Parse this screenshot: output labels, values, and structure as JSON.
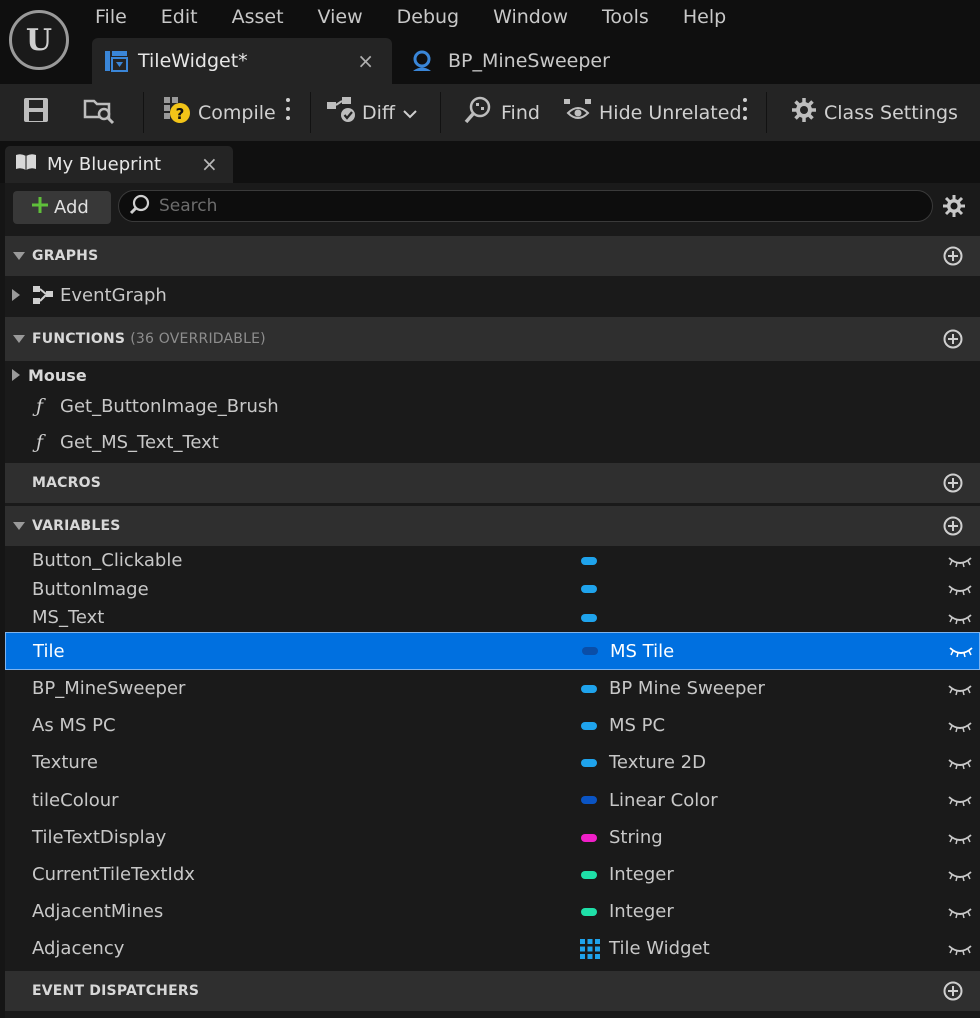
{
  "menu": [
    "File",
    "Edit",
    "Asset",
    "View",
    "Debug",
    "Window",
    "Tools",
    "Help"
  ],
  "logo_text": "U",
  "tabs": [
    {
      "label": "TileWidget*",
      "close": "×"
    },
    {
      "label": "BP_MineSweeper"
    }
  ],
  "toolbar": {
    "compile": "Compile",
    "diff": "Diff",
    "find": "Find",
    "hide_unrelated": "Hide Unrelated",
    "class_settings": "Class Settings"
  },
  "panel": {
    "tab_label": "My Blueprint",
    "tab_close": "×",
    "add_label": "Add",
    "search_placeholder": "Search"
  },
  "sections": {
    "graphs": "GRAPHS",
    "functions": "FUNCTIONS",
    "functions_count": "(36 OVERRIDABLE)",
    "macros": "MACROS",
    "variables": "VARIABLES",
    "event_dispatchers": "EVENT DISPATCHERS"
  },
  "graphs": [
    "EventGraph"
  ],
  "function_category": "Mouse",
  "functions": [
    "Get_ButtonImage_Brush",
    "Get_MS_Text_Text"
  ],
  "variables": [
    {
      "name": "Button_Clickable",
      "type": "",
      "color": "#1fa3ec"
    },
    {
      "name": "ButtonImage",
      "type": "",
      "color": "#1fa3ec"
    },
    {
      "name": "MS_Text",
      "type": "",
      "color": "#1fa3ec"
    },
    {
      "name": "Tile",
      "type": "MS Tile",
      "color": "#0a4ea8",
      "selected": true
    },
    {
      "name": "BP_MineSweeper",
      "type": "BP Mine Sweeper",
      "color": "#1fa3ec"
    },
    {
      "name": "As MS PC",
      "type": "MS PC",
      "color": "#1fa3ec"
    },
    {
      "name": "Texture",
      "type": "Texture 2D",
      "color": "#1fa3ec"
    },
    {
      "name": "tileColour",
      "type": "Linear Color",
      "color": "#0a54c4"
    },
    {
      "name": "TileTextDisplay",
      "type": "String",
      "color": "#f01fc8"
    },
    {
      "name": "CurrentTileTextIdx",
      "type": "Integer",
      "color": "#1fe0a8"
    },
    {
      "name": "AdjacentMines",
      "type": "Integer",
      "color": "#1fe0a8"
    },
    {
      "name": "Adjacency",
      "type": "Tile Widget",
      "color": "#1fa3ec",
      "array": true
    }
  ]
}
